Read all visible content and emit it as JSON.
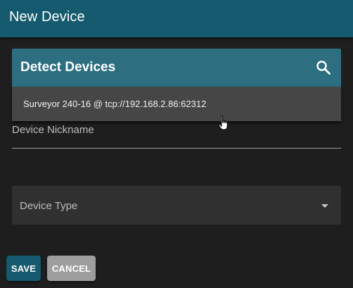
{
  "dialog": {
    "title": "New Device"
  },
  "detect": {
    "title": "Detect Devices",
    "search_icon": "search-icon"
  },
  "devices": {
    "items": [
      {
        "label": "Surveyor 240-16 @ tcp://192.168.2.86:62312"
      }
    ]
  },
  "form": {
    "nickname_label": "Device Nickname",
    "nickname_value": "",
    "type_label": "Device Type"
  },
  "actions": {
    "save_label": "SAVE",
    "cancel_label": "CANCEL"
  },
  "colors": {
    "header": "#155a6e",
    "detect_bar": "#2d6e80",
    "background": "#1e1e1e",
    "list_item": "#464646",
    "select": "#303030",
    "cancel_button": "#9e9e9e"
  }
}
